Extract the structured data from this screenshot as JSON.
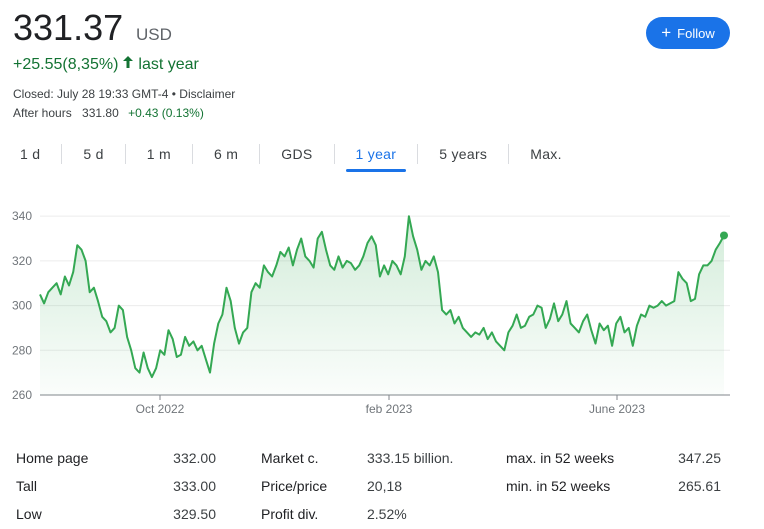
{
  "quote": {
    "price": "331.37",
    "currency": "USD",
    "change": "+25.55(8,35%)",
    "period": "last year",
    "closed": "Closed: July 28 19:33 GMT-4 • Disclaimer",
    "after_label": "After hours",
    "after_value": "331.80",
    "after_change": "+0.43 (0.13%)"
  },
  "follow": {
    "label": "Follow"
  },
  "tabs": [
    {
      "label": "1 d"
    },
    {
      "label": "5 d"
    },
    {
      "label": "1 m"
    },
    {
      "label": "6 m"
    },
    {
      "label": "GDS"
    },
    {
      "label": "1 year",
      "active": true
    },
    {
      "label": "5 years"
    },
    {
      "label": "Max."
    }
  ],
  "colors": {
    "line": "#34a853",
    "accent": "#1a73e8",
    "positive": "#137333"
  },
  "chart_data": {
    "type": "line",
    "title": "",
    "xlabel": "",
    "ylabel": "",
    "ylim": [
      260,
      345
    ],
    "y_ticks": [
      260,
      280,
      300,
      320,
      340
    ],
    "x_tick_labels": [
      "Oct 2022",
      "feb 2023",
      "June 2023"
    ],
    "grid": true,
    "legend": "none",
    "series": [
      {
        "values": [
          305,
          301,
          306,
          308,
          310,
          305,
          313,
          309,
          315,
          327,
          325,
          320,
          306,
          308,
          302,
          295,
          293,
          288,
          290,
          300,
          298,
          286,
          280,
          272,
          270,
          279,
          272,
          268,
          272,
          280,
          278,
          289,
          285,
          277,
          278,
          286,
          282,
          284,
          280,
          282,
          276,
          270,
          283,
          292,
          296,
          308,
          302,
          290,
          283,
          288,
          290,
          306,
          310,
          308,
          318,
          315,
          313,
          318,
          324,
          322,
          326,
          318,
          325,
          330,
          322,
          320,
          317,
          330,
          333,
          325,
          318,
          316,
          322,
          317,
          320,
          319,
          316,
          318,
          322,
          328,
          331,
          327,
          313,
          318,
          314,
          320,
          318,
          314,
          322,
          340,
          331,
          325,
          316,
          320,
          318,
          322,
          315,
          298,
          296,
          298,
          292,
          295,
          290,
          288,
          286,
          288,
          287,
          290,
          285,
          288,
          284,
          282,
          280,
          288,
          291,
          296,
          290,
          291,
          295,
          296,
          300,
          299,
          290,
          294,
          301,
          293,
          296,
          302,
          292,
          290,
          288,
          293,
          296,
          289,
          283,
          292,
          289,
          291,
          282,
          292,
          295,
          288,
          290,
          282,
          291,
          296,
          295,
          300,
          299,
          300,
          302,
          300,
          301,
          302,
          315,
          312,
          310,
          302,
          303,
          314,
          318,
          318,
          320,
          325,
          328,
          331.37
        ]
      }
    ],
    "last_point": 331.37
  },
  "stats": {
    "rows": [
      {
        "l1": "Home page",
        "v1": "332.00",
        "l2": "Market c.",
        "v2": "333.15 billion.",
        "l3": "max. in 52 weeks",
        "v3": "347.25"
      },
      {
        "l1": "Tall",
        "v1": "333.00",
        "l2": "Price/price",
        "v2": "20,18",
        "l3": "min. in 52 weeks",
        "v3": "265.61"
      },
      {
        "l1": "Low",
        "v1": "329.50",
        "l2": "Profit div.",
        "v2": "2.52%",
        "l3": "",
        "v3": ""
      }
    ]
  }
}
